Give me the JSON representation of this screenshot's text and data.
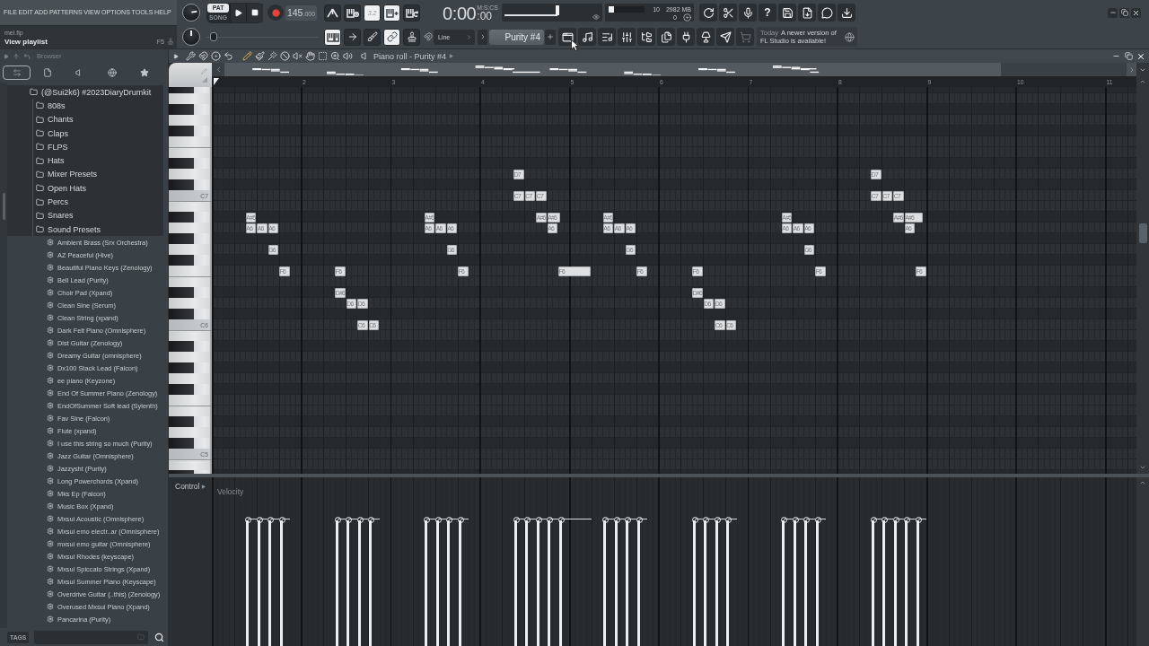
{
  "menu": [
    "FILE",
    "EDIT",
    "ADD",
    "PATTERNS",
    "VIEW",
    "OPTIONS",
    "TOOLS",
    "HELP"
  ],
  "hint": {
    "file": "mel.flp",
    "text": "View playlist",
    "shortcut": "F5"
  },
  "knobs": [
    {
      "level": 0.8
    },
    {
      "level": 0.5
    }
  ],
  "modes": [
    {
      "label": "PAT",
      "selected": true
    },
    {
      "label": "SONG",
      "selected": false
    }
  ],
  "transport": [
    {
      "kind": "play"
    },
    {
      "kind": "stop"
    },
    {
      "kind": "record"
    }
  ],
  "tempo": {
    "value": "145",
    "fraction": ".000"
  },
  "record_buttons": [
    {
      "kind": "metronome",
      "on": false
    },
    {
      "kind": "wait",
      "on": false
    },
    {
      "kind": "countdown",
      "label": "3.2",
      "on": true
    },
    {
      "kind": "step",
      "on": true
    },
    {
      "kind": "loop",
      "on": false
    }
  ],
  "time": {
    "value": "0:00",
    "format": "M:S:CS",
    "centiseconds": ":00"
  },
  "song_position": {
    "level": 0.55
  },
  "monitor": {
    "level": 0.15,
    "voices": "10",
    "memory": "2982 MB",
    "cpu": "0"
  },
  "app_buttons": [
    {
      "kind": "undo"
    },
    {
      "kind": "cut"
    },
    {
      "kind": "mic"
    },
    {
      "kind": "help",
      "label": "?"
    },
    {
      "kind": "save"
    },
    {
      "kind": "export"
    },
    {
      "kind": "chat"
    },
    {
      "kind": "download"
    }
  ],
  "pitch": {
    "level": 0.03
  },
  "edit_buttons": [
    {
      "kind": "typing",
      "on": true
    },
    {
      "kind": "arrow",
      "on": false
    },
    {
      "kind": "brush",
      "on": false
    },
    {
      "kind": "link",
      "on": true
    },
    {
      "kind": "stamp",
      "on": false
    },
    {
      "kind": "snap",
      "on": false
    }
  ],
  "snap": {
    "label": "Line"
  },
  "pattern": {
    "label": "Purity #4"
  },
  "window_buttons": [
    {
      "kind": "playlist",
      "disabled": false
    },
    {
      "kind": "pianoroll",
      "disabled": false
    },
    {
      "kind": "channels",
      "disabled": false
    },
    {
      "kind": "mixer",
      "disabled": false
    },
    {
      "kind": "browser",
      "disabled": false
    },
    {
      "kind": "project",
      "disabled": false
    },
    {
      "kind": "plugins",
      "disabled": false
    },
    {
      "kind": "tutorial",
      "disabled": false
    },
    {
      "kind": "send",
      "disabled": false
    },
    {
      "kind": "shop",
      "disabled": true
    }
  ],
  "news": {
    "date": "Today",
    "message": "A newer version of FL Studio is available!"
  },
  "browser": {
    "title": "Browser",
    "tabs": [
      {
        "kind": "all",
        "selected": true
      },
      {
        "kind": "files",
        "selected": false
      },
      {
        "kind": "plugins",
        "selected": false
      },
      {
        "kind": "online",
        "selected": false
      },
      {
        "kind": "favorites",
        "selected": false
      }
    ],
    "tree": [
      {
        "kind": "folder",
        "label": "(@Sui2k6) #2023DiaryDrumkit",
        "children": [
          {
            "kind": "folder",
            "label": "808s"
          },
          {
            "kind": "folder",
            "label": "Chants"
          },
          {
            "kind": "folder",
            "label": "Claps"
          },
          {
            "kind": "folder",
            "label": "FLPS"
          },
          {
            "kind": "folder",
            "label": "Hats"
          },
          {
            "kind": "folder",
            "label": "Mixer Presets"
          },
          {
            "kind": "folder",
            "label": "Open Hats"
          },
          {
            "kind": "folder",
            "label": "Percs"
          },
          {
            "kind": "folder",
            "label": "Snares"
          },
          {
            "kind": "folder",
            "label": "Sound Presets",
            "children": [
              {
                "kind": "preset",
                "label": "Ambient Brass (Srx Orchestra)"
              },
              {
                "kind": "preset",
                "label": "AZ Peaceful (Hive)"
              },
              {
                "kind": "preset",
                "label": "Beautiful Piano Keys (Zenology)"
              },
              {
                "kind": "preset",
                "label": "Bell Lead (Purity)"
              },
              {
                "kind": "preset",
                "label": "Choir Pad (Xpand)"
              },
              {
                "kind": "preset",
                "label": "Clean Sine (Serum)"
              },
              {
                "kind": "preset",
                "label": "Clean String (xpand)"
              },
              {
                "kind": "preset",
                "label": "Dark Felt Piano (Omnisphere)"
              },
              {
                "kind": "preset",
                "label": "Dist Guitar (Zenology)"
              },
              {
                "kind": "preset",
                "label": "Dreamy Guitar (omnisphere)"
              },
              {
                "kind": "preset",
                "label": "Dx100 Stack Lead (Falcon)"
              },
              {
                "kind": "preset",
                "label": "ee piano (Keyzone)"
              },
              {
                "kind": "preset",
                "label": "End Of Summer Piano (Zenology)"
              },
              {
                "kind": "preset",
                "label": "EndOfSummer Soft lead (Sylenth)"
              },
              {
                "kind": "preset",
                "label": "Fav Sine (Falcon)"
              },
              {
                "kind": "preset",
                "label": "Flute (xpand)"
              },
              {
                "kind": "preset",
                "label": "I use this string so much (Purity)"
              },
              {
                "kind": "preset",
                "label": "Jazz Guitar (Omnisphere)"
              },
              {
                "kind": "preset",
                "label": "Jazzysht (Purity)"
              },
              {
                "kind": "preset",
                "label": "Long Powerchords (Xpand)"
              },
              {
                "kind": "preset",
                "label": "Mks Ep (Falcon)"
              },
              {
                "kind": "preset",
                "label": "Music Box (Xpand)"
              },
              {
                "kind": "preset",
                "label": "Mxsui Acoustic (Omnisphere)"
              },
              {
                "kind": "preset",
                "label": "Mxsui emo electr..ar (Omnisphere)"
              },
              {
                "kind": "preset",
                "label": "mxsui emo guitar (Omnisphere)"
              },
              {
                "kind": "preset",
                "label": "Mxsui Rhodes (keyscape)"
              },
              {
                "kind": "preset",
                "label": "Mxsui Spiccato Strings (Xpand)"
              },
              {
                "kind": "preset",
                "label": "Mxsui Summer Piano (Keyscape)"
              },
              {
                "kind": "preset",
                "label": "Overdrive Guitar (..this) (Zenology)"
              },
              {
                "kind": "preset",
                "label": "Overused Mxsui Piano (Xpand)"
              },
              {
                "kind": "preset",
                "label": "Pancarina (Purity)"
              }
            ]
          }
        ]
      }
    ],
    "tags": "TAGS"
  },
  "piano_roll": {
    "title": "Piano roll - Purity #4",
    "menu": [
      {
        "kind": "menu"
      },
      {
        "kind": "options"
      },
      {
        "kind": "snap"
      },
      {
        "kind": "target"
      },
      {
        "kind": "undo"
      }
    ],
    "tools": [
      {
        "kind": "draw",
        "selected": true
      },
      {
        "kind": "paint",
        "selected": false
      },
      {
        "kind": "slide",
        "selected": false
      },
      {
        "kind": "delete",
        "selected": false
      },
      {
        "kind": "mute",
        "selected": false
      },
      {
        "kind": "slip",
        "selected": false
      },
      {
        "kind": "select",
        "selected": false
      },
      {
        "kind": "zoom",
        "selected": false
      },
      {
        "kind": "playback",
        "selected": false
      }
    ],
    "bars": [
      "2",
      "3",
      "4",
      "5",
      "6",
      "7",
      "8",
      "9",
      "10",
      "11"
    ],
    "keys": [
      {
        "kind": "black"
      },
      {
        "kind": "white"
      },
      {
        "kind": "black"
      },
      {
        "kind": "white"
      },
      {
        "kind": "black"
      },
      {
        "kind": "white"
      },
      {
        "kind": "white"
      },
      {
        "kind": "black"
      },
      {
        "kind": "white",
        "notes": [
          {
            "label": "D7"
          },
          {
            "label": "D7"
          }
        ]
      },
      {
        "kind": "black"
      },
      {
        "kind": "white",
        "label": "C7",
        "notes": [
          {
            "label": "C7"
          },
          {
            "label": "C7"
          },
          {
            "label": "C7"
          },
          {
            "label": "C7"
          },
          {
            "label": "C7"
          },
          {
            "label": "C7"
          }
        ]
      },
      {
        "kind": "white"
      },
      {
        "kind": "black",
        "notes": [
          {
            "label": "A#6"
          },
          {
            "label": "A#6"
          },
          {
            "label": "A#6"
          },
          {
            "label": "A#6"
          },
          {
            "label": "A#6"
          },
          {
            "label": "A#6"
          },
          {
            "label": "A#6"
          },
          {
            "label": "A#6"
          }
        ]
      },
      {
        "kind": "white",
        "notes": [
          {
            "label": "A6"
          },
          {
            "label": "A6"
          },
          {
            "label": "A6"
          },
          {
            "label": "A6"
          },
          {
            "label": "A6"
          },
          {
            "label": "A6"
          },
          {
            "label": "A6"
          },
          {
            "label": "A6"
          },
          {
            "label": "A6"
          },
          {
            "label": "A6"
          },
          {
            "label": "A6"
          },
          {
            "label": "A6"
          },
          {
            "label": "A6"
          },
          {
            "label": "A6"
          }
        ]
      },
      {
        "kind": "black"
      },
      {
        "kind": "white",
        "notes": [
          {
            "label": "G6"
          },
          {
            "label": "G6"
          },
          {
            "label": "G6"
          },
          {
            "label": "G6"
          }
        ]
      },
      {
        "kind": "black"
      },
      {
        "kind": "white",
        "notes": [
          {
            "label": "F6"
          },
          {
            "label": "F6"
          },
          {
            "label": "F6"
          },
          {
            "label": "F6"
          },
          {
            "label": "F6"
          },
          {
            "label": "F6"
          },
          {
            "label": "F6"
          },
          {
            "label": "F6"
          }
        ]
      },
      {
        "kind": "white"
      },
      {
        "kind": "black",
        "notes": [
          {
            "label": "D#6"
          },
          {
            "label": "D#6"
          }
        ]
      },
      {
        "kind": "white",
        "notes": [
          {
            "label": "D6"
          },
          {
            "label": "D6"
          },
          {
            "label": "D6"
          },
          {
            "label": "D6"
          }
        ]
      },
      {
        "kind": "black"
      },
      {
        "kind": "white",
        "label": "C6",
        "notes": [
          {
            "label": "C6"
          },
          {
            "label": "C6"
          },
          {
            "label": "C6"
          },
          {
            "label": "C6"
          }
        ]
      },
      {
        "kind": "white"
      },
      {
        "kind": "black"
      },
      {
        "kind": "white"
      },
      {
        "kind": "black"
      },
      {
        "kind": "white"
      },
      {
        "kind": "black"
      },
      {
        "kind": "white"
      },
      {
        "kind": "white"
      },
      {
        "kind": "black"
      },
      {
        "kind": "white"
      },
      {
        "kind": "black"
      },
      {
        "kind": "white",
        "label": "C5"
      },
      {
        "kind": "white"
      },
      {
        "kind": "black"
      }
    ],
    "control": "Control",
    "parameter": "Velocity"
  }
}
